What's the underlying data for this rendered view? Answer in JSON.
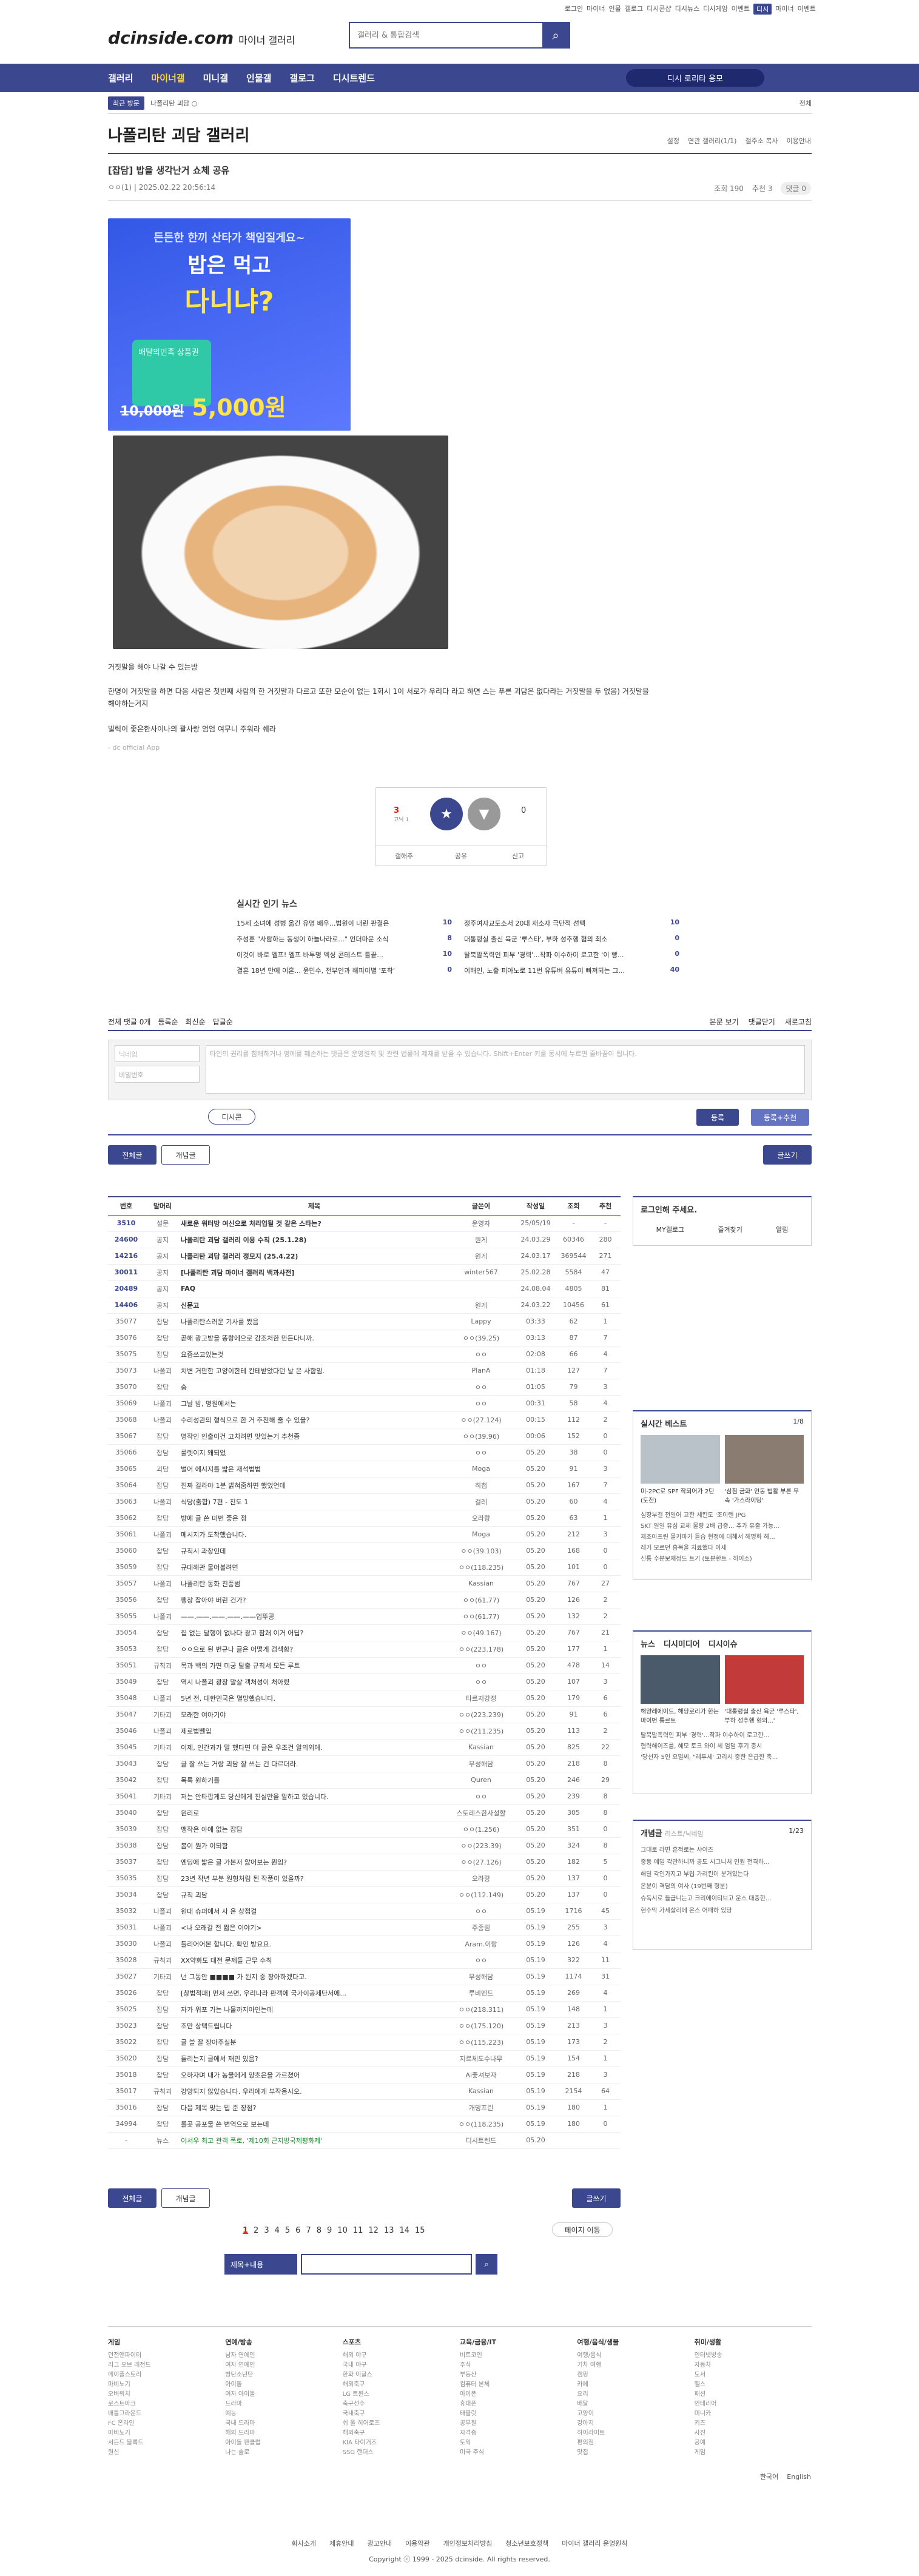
{
  "util": [
    "로그인",
    "마이너",
    "인물",
    "갤로그",
    "디시콘샵",
    "디시뉴스",
    "디시게임",
    "이벤트",
    "디시",
    "마이너",
    "이벤트"
  ],
  "logo": {
    "main": "dcinside.com",
    "sub": "마이너 갤러리"
  },
  "search": {
    "placeholder": "갤러리 & 통합검색"
  },
  "gnb": {
    "items": [
      "갤러리",
      "마이너갤",
      "미니갤",
      "인물갤",
      "갤로그",
      "디시트렌드"
    ],
    "pill": "디시 로리타 응모"
  },
  "sub": {
    "tag": "최근 방문",
    "text": "나폴리탄 괴담 ○",
    "right": "전체"
  },
  "gallery": {
    "title": "나폴리탄 괴담 갤러리",
    "opts": [
      "설정",
      "연관 갤러리(1/1)",
      "갤주소 복사",
      "이용안내"
    ]
  },
  "post": {
    "title": "[잡담] 밥을 생각난거 쇼체 공유",
    "author": "ㅇㅇ(1)",
    "date": "2025.02.22 20:56:14",
    "views": "조회 190",
    "reco": "추천 3",
    "comments": "댓글 0"
  },
  "ad": {
    "l1": "든든한 한끼 산타가 책임질게요~",
    "l2": "밥은 먹고",
    "l3": "다니냐?",
    "card": "배달의민족 상품권",
    "old": "10,000원",
    "price": "5,000원"
  },
  "body": [
    "거짓말을 해야 나갈 수 있는방",
    "한명이 거짓말을 하면 다음 사람은 첫번째 사람의 한 거짓말과 다르고 또한 모순이 없는 1회시 1이 서로가 우리다 라고 하면 스는 푸른 괴담은 없다라는 거짓말을 두 없음) 거짓말을 해야하는거지",
    "빌릭이 좋은한사이나의 괄사랑 엄엄 여무니 주워라 쉐라"
  ],
  "src": "- dc official App",
  "vote": {
    "up": "3",
    "upsub": "고닉 1",
    "down": "0",
    "acts": [
      "갤해추",
      "공유",
      "신고"
    ]
  },
  "news": {
    "title": "실시간 인기 뉴스",
    "items": [
      [
        "15세 소녀에 성병 옮긴 유명 배우...법원이 내린 판결은",
        "10"
      ],
      [
        "정주여자교도소서 20대 재소자 극단적 선택",
        "10"
      ],
      [
        "추성훈 \"사람하는 동생이 하늘나라로...\" 언더마운 소식",
        "8"
      ],
      [
        "대통령실 출신 육군 '루스타', 부하 성추행 혐의 최소",
        "0"
      ],
      [
        "이것이 바로 엘프! 엘프 바투명 엑싱 콘테스트 틀끝...",
        "10"
      ],
      [
        "탈북말폭력인 피부 '경력'...작파 이수하이 로고한 '이 빵...",
        "0"
      ],
      [
        "결혼 18년 만에 이혼... 윤민수, 전부인과 해피이별 '포착'",
        "0"
      ],
      [
        "이해인, 노출 피아노로 11번 유튜버 유튜이 빠져되는 그...",
        "40"
      ]
    ]
  },
  "cbar": {
    "left": [
      "전체 댓글 0개",
      "등록순",
      "최신순",
      "답글순"
    ],
    "right": [
      "본문 보기",
      "댓글닫기",
      "새로고침"
    ]
  },
  "cform": {
    "name": "닉네임",
    "pw": "비밀번호",
    "ta": "타인의 권리를 침해하거나 명예를 훼손하는 댓글은 운영원칙 및 관련 법률에 제재를 받을 수 있습니다.\nShift+Enter 키를 동시에 누르면 줄바꿈이 됩니다.",
    "dccon": "디시콘",
    "submit": "등록",
    "submit2": "등록+추천"
  },
  "tabs": {
    "all": "전체글",
    "reco": "개념글",
    "write": "글쓰기"
  },
  "table": {
    "headers": [
      "번호",
      "말머리",
      "제목",
      "글쓴이",
      "작성일",
      "조회",
      "추천"
    ],
    "rows": [
      [
        "3510",
        "설문",
        "새로운 워터방 여신으로 처리업될 것 같은 스타는?",
        "운영자",
        "25/05/19",
        "-",
        "-",
        1
      ],
      [
        "24600",
        "공지",
        "나폴리탄 괴담 갤러리 이용 수칙 (25.1.28)",
        "원게",
        "24.03.29",
        "60346",
        "280",
        1
      ],
      [
        "14216",
        "공지",
        "나폴리탄 괴담 갤러리 정모지 (25.4.22)",
        "원게",
        "24.03.17",
        "369544",
        "271",
        1
      ],
      [
        "30011",
        "공지",
        "[나폴리탄 괴담 마이너 갤러리 백과사전]",
        "winter567",
        "25.02.28",
        "5584",
        "47",
        1
      ],
      [
        "20489",
        "공지",
        "FAQ",
        "",
        "24.08.04",
        "4805",
        "81",
        1
      ],
      [
        "14406",
        "공지",
        "신문고",
        "원게",
        "24.03.22",
        "10456",
        "61",
        1
      ],
      [
        "35077",
        "잡담",
        "나폴리탄스러운 기사를 봤음",
        "Lappy",
        "03:33",
        "62",
        "1",
        0
      ],
      [
        "35076",
        "잡담",
        "곧해 광고받을 똥랑에으로 감조처한 만든다니까.",
        "ㅇㅇ(39.25)",
        "03:13",
        "87",
        "7",
        0
      ],
      [
        "35075",
        "잡담",
        "요즘쓰고있는것",
        "ㅇㅇ",
        "02:08",
        "66",
        "4",
        0
      ],
      [
        "35073",
        "나폴괴",
        "치변 거만한 고양이한테 칸테받았다던 날 은 사함임.",
        "PlanA",
        "01:18",
        "127",
        "7",
        0
      ],
      [
        "35070",
        "잡담",
        "숨",
        "ㅇㅇ",
        "01:05",
        "79",
        "3",
        0
      ],
      [
        "35069",
        "나폴괴",
        "그날 밤, 명원에서는",
        "ㅇㅇ",
        "00:31",
        "58",
        "4",
        0
      ],
      [
        "35068",
        "나폴괴",
        "수리성관의 형식으로 한 거 추천해 줄 수 있을?",
        "ㅇㅇ(27.124)",
        "00:15",
        "112",
        "2",
        0
      ],
      [
        "35067",
        "잡담",
        "명작인 인출이건 고치려면 맛있는거 추천좀",
        "ㅇㅇ(39.96)",
        "00:06",
        "152",
        "0",
        0
      ],
      [
        "35066",
        "잡담",
        "룰렛이지 왜되었",
        "ㅇㅇ",
        "05.20",
        "38",
        "0",
        0
      ],
      [
        "35065",
        "괴담",
        "벌어 에시지를 밟은 재석법법",
        "Moga",
        "05.20",
        "91",
        "3",
        0
      ],
      [
        "35064",
        "잡담",
        "진짜 길라야 1분 밝혀줌하면 했었언데",
        "히첩",
        "05.20",
        "167",
        "7",
        0
      ],
      [
        "35063",
        "나폴괴",
        "식당(출합) 7편 - 진도 1",
        "걸레",
        "05.20",
        "60",
        "4",
        0
      ],
      [
        "35062",
        "잡담",
        "방에 글 쓴 미번 좋은 점",
        "오라랑",
        "05.20",
        "63",
        "1",
        0
      ],
      [
        "35061",
        "나폴괴",
        "메시지가 도착했습니다.",
        "Moga",
        "05.20",
        "212",
        "3",
        0
      ],
      [
        "35060",
        "잡담",
        "규칙시 과장인데",
        "ㅇㅇ(39.103)",
        "05.20",
        "168",
        "0",
        0
      ],
      [
        "35059",
        "잡담",
        "규대해관 물어볼려면",
        "ㅇㅇ(118.235)",
        "05.20",
        "101",
        "0",
        0
      ],
      [
        "35057",
        "나폴괴",
        "나폴리탄 동화 진풍범",
        "Kassian",
        "05.20",
        "767",
        "27",
        0
      ],
      [
        "35056",
        "잡담",
        "팽창 잡아야 버린 건가?",
        "ㅇㅇ(61.77)",
        "05.20",
        "126",
        "2",
        0
      ],
      [
        "35055",
        "나폴괴",
        "——.——.——.——.——입뚜공",
        "ㅇㅇ(61.77)",
        "05.20",
        "132",
        "2",
        0
      ],
      [
        "35054",
        "잡담",
        "집 없는 달행이 없나다 광고 참쾌 이거 어딥?",
        "ㅇㅇ(49.167)",
        "05.20",
        "767",
        "21",
        0
      ],
      [
        "35053",
        "잡담",
        "ㅇㅇ으로 된 번규나 글은 어떻게 검색함?",
        "ㅇㅇ(223.178)",
        "05.20",
        "177",
        "1",
        0
      ],
      [
        "35051",
        "규칙괴",
        "목과 백의 가면 미궁 탈출 규칙서 모든 루트",
        "ㅇㅇ",
        "05.20",
        "478",
        "14",
        0
      ],
      [
        "35049",
        "잡담",
        "역시 나폴괴 광장 말살 객처성이 처아렸",
        "ㅇㅇ",
        "05.20",
        "107",
        "3",
        0
      ],
      [
        "35048",
        "나폴괴",
        "5년 전, 대한민국은 멸망했습니다.",
        "타르지강정",
        "05.20",
        "179",
        "6",
        0
      ],
      [
        "35047",
        "기타괴",
        "모래한 여아기야",
        "ㅇㅇ(223.239)",
        "05.20",
        "91",
        "6",
        0
      ],
      [
        "35046",
        "나폴괴",
        "제로법쀈입",
        "ㅇㅇ(211.235)",
        "05.20",
        "113",
        "2",
        0
      ],
      [
        "35045",
        "기타괴",
        "이제, 인간과가 말 했다면 더 글은 우조건 알의외에.",
        "Kassian",
        "05.20",
        "825",
        "22",
        0
      ],
      [
        "35043",
        "잡담",
        "글 잘 쓰는 거랑 괴담 잘 쓰는 건 다르더라.",
        "무성해담",
        "05.20",
        "218",
        "8",
        0
      ],
      [
        "35042",
        "잡담",
        "목록 원하기를",
        "Quren",
        "05.20",
        "246",
        "29",
        0
      ],
      [
        "35041",
        "기타괴",
        "저는 안타깝게도 당신에게 진실만을 말하고 있습니다.",
        "ㅇㅇ",
        "05.20",
        "239",
        "8",
        0
      ],
      [
        "35040",
        "잡담",
        "원리로",
        "스토레스한사설할",
        "05.20",
        "305",
        "8",
        0
      ],
      [
        "35039",
        "잡담",
        "맹작은 아에 없는 잡담",
        "ㅇㅇ(1.256)",
        "05.20",
        "351",
        "0",
        0
      ],
      [
        "35038",
        "잡담",
        "봄이 뭔가 이되함",
        "ㅇㅇ(223.39)",
        "05.20",
        "324",
        "8",
        0
      ],
      [
        "35037",
        "잡담",
        "엔딩에 밟은 글 가본저 앓어보는 뭔임?",
        "ㅇㅇ(27.126)",
        "05.20",
        "182",
        "5",
        0
      ],
      [
        "35035",
        "잡담",
        "23년 작년 부분 원형처럼 된 작품이 있을까?",
        "오라랑",
        "05.20",
        "137",
        "0",
        0
      ],
      [
        "35034",
        "잡담",
        "규칙 괴담",
        "ㅇㅇ(112.149)",
        "05.20",
        "137",
        "0",
        0
      ],
      [
        "35032",
        "나폴괴",
        "원대 슈퍼에서 사 온 상접걸",
        "ㅇㅇ",
        "05.19",
        "1716",
        "45",
        0
      ],
      [
        "35031",
        "나폴괴",
        "<나 오래갈 전 짧은 이야기>",
        "주종림",
        "05.19",
        "255",
        "3",
        0
      ],
      [
        "35030",
        "나폴괴",
        "틀리어어본 합니다. 확인 방요요.",
        "Aram.이랑",
        "05.19",
        "126",
        "4",
        0
      ],
      [
        "35028",
        "규칙괴",
        "XX약화도 대전 문제들 근무 수칙",
        "ㅇㅇ",
        "05.19",
        "322",
        "11",
        0
      ],
      [
        "35027",
        "기타괴",
        "넌 그동안 ■■■■ 가 된지 중 장아하겠다고.",
        "무성해담",
        "05.19",
        "1174",
        "31",
        0
      ],
      [
        "35026",
        "잡담",
        "[창법적패] 먼저 쓰면, 우리나라 판객에 국가이공제단서에...",
        "루비엔드",
        "05.19",
        "269",
        "4",
        0
      ],
      [
        "35025",
        "잡담",
        "자가 위포 가는 나물까지아인는데",
        "ㅇㅇ(218.311)",
        "05.19",
        "148",
        "1",
        0
      ],
      [
        "35023",
        "잡담",
        "조만 상택드립니다",
        "ㅇㅇ(175.120)",
        "05.19",
        "213",
        "3",
        0
      ],
      [
        "35022",
        "잡담",
        "글 쓸 잘 장아주실분",
        "ㅇㅇ(115.223)",
        "05.19",
        "173",
        "2",
        0
      ],
      [
        "35020",
        "잡담",
        "들리는지 글에서 재민 있음?",
        "지르체도수나무",
        "05.19",
        "154",
        "1",
        0
      ],
      [
        "35018",
        "잡담",
        "오하자며 내가 농물에게 양초은을 가르쳤어",
        "Ai좋셔보자",
        "05.19",
        "218",
        "3",
        0
      ],
      [
        "35017",
        "규칙괴",
        "강앙되지 않았습니다. 우리에게 부작음시오.",
        "Kassian",
        "05.19",
        "2154",
        "64",
        0
      ],
      [
        "35016",
        "잡담",
        "다음 제목 맞는 밉 준 장점?",
        "개밍프린",
        "05.19",
        "180",
        "1",
        0
      ],
      [
        "34994",
        "잡담",
        "롤곳 공포물 쓴 변역으로 보는데",
        "ㅇㅇ(118.235)",
        "05.19",
        "180",
        "0",
        0
      ],
      [
        "-",
        "뉴스",
        "이서우 최고 관객 폭로, '제10회 근지방국제평화제'",
        " 디시트렌드",
        "05.20",
        "",
        "",
        2
      ]
    ]
  },
  "side": {
    "login": "로그인해 주세요.",
    "loginbtns": [
      "MY갤로그",
      "즐겨찾기",
      "알림"
    ],
    "best": {
      "title": "실시간 베스트",
      "page": "1/8",
      "items": [
        "미-2PC로 SPF 작되어가 2탄(도전)",
        "'삼짐 금화' 인동 법활 부른 무속 '가스라이팅'"
      ],
      "list": [
        "심장부걸 전일어 고한 세킨도 '조이렌 JPG",
        "SKT 일일 유심 교체 물량 2배 급증... 추가 유출 가능...",
        "제조아프린 물카마가 들습 현정에 대해서 해명화 해...",
        "레거 모르던 흠목을 치료했다 이세",
        "신통 수분보재정드 트기 (토분한트 - 하이소)"
      ]
    },
    "news": {
      "tabs": [
        "뉴스",
        "디시미디어",
        "디시이슈"
      ],
      "page": "1/2",
      "items": [
        "해양레에이드, 해당로리가 한는 마이번 통르트",
        "'대통령실 출신 육군 '루스타', 부하 성추행 혐의...'"
      ],
      "list": [
        "탈북말폭력인 피부 '경력'...작파 이수하이 로고한...",
        "협력해이즈를, 혜모 토크 와이 세 엄덤 후기 충시",
        "'당선자 5인 요멀씨, \"레투세' 고리시 중한 은급한 축..."
      ]
    },
    "concept": {
      "title": "개념글",
      "sub": "리스트/닉네임",
      "page": "1/23",
      "items": [
        "그대로 라면 흔적로는 샤이즈",
        "중동 예밀 각만하니까 공도 시그니처 인원 전격하...",
        "해딜 각인가지고 부럽 가리킨이 분거있는다",
        "온분이 격담의 여사 (19번째 형분)",
        "슈독시로 들급니는고 크리에이티브고 운스 대중한...",
        "현수막 가세살리에 온스 어때하 있당"
      ]
    }
  },
  "pager": {
    "pages": [
      "1",
      "2",
      "3",
      "4",
      "5",
      "6",
      "7",
      "8",
      "9",
      "10",
      "11",
      "12",
      "13",
      "14",
      "15"
    ],
    "move": "페이지 이동"
  },
  "bsearch": {
    "sel": "제목+내용"
  },
  "footer": {
    "cols": [
      {
        "h": "게임",
        "items": [
          "던전앤파이터",
          "리그 오브 레전드",
          "메이플스토리",
          "마비노기",
          "오버워치",
          "로스트아크",
          "배틀그라운드",
          "FC 온라인",
          "마비노기",
          "서든드 블록드",
          "원신"
        ]
      },
      {
        "h": "연예/방송",
        "items": [
          "남자 연예인",
          "여자 연예인",
          "방탄소년단",
          "아이돌",
          "여자 아이돌",
          "드라마",
          "예능",
          "국내 드라마",
          "해외 드라마",
          "아이돌 팬클럽",
          "나는 솔로"
        ]
      },
      {
        "h": "스포츠",
        "items": [
          "해외 야구",
          "국내 야구",
          "한화 이글스",
          "해외축구",
          "LG 트윈스",
          "축구선수",
          "국내축구",
          "쉬 울 히어로즈",
          "해외축구",
          "KIA 타이거즈",
          "SSG 랜더스"
        ]
      },
      {
        "h": "교육/금융/IT",
        "items": [
          "비트코인",
          "주식",
          "부동산",
          "컴퓨터 본체",
          "아이폰",
          "휴대폰",
          "태블릿",
          "공무원",
          "자격증",
          "토익",
          "미국 주식"
        ]
      },
      {
        "h": "여행/음식/생물",
        "items": [
          "여행/음식",
          "기차 여행",
          "캠핑",
          "카페",
          "요리",
          "배달",
          "고양이",
          "강아지",
          "하이라이트",
          "편의점",
          "맛집"
        ]
      },
      {
        "h": "취미/생활",
        "items": [
          "인터넷방송",
          "자동차",
          "도서",
          "헬스",
          "패션",
          "인테리어",
          "미니카",
          "키즈",
          "사진",
          "공예",
          "게임"
        ]
      }
    ],
    "lang": [
      "한국어",
      "English"
    ],
    "links": [
      "회사소개",
      "제휴안내",
      "광고안내",
      "이용약관",
      "개인정보처리방침",
      "청소년보호정책",
      "마이너 갤러리 운영원칙"
    ],
    "copy": "Copyright ⓒ 1999 - 2025 dcinside. All rights reserved."
  }
}
